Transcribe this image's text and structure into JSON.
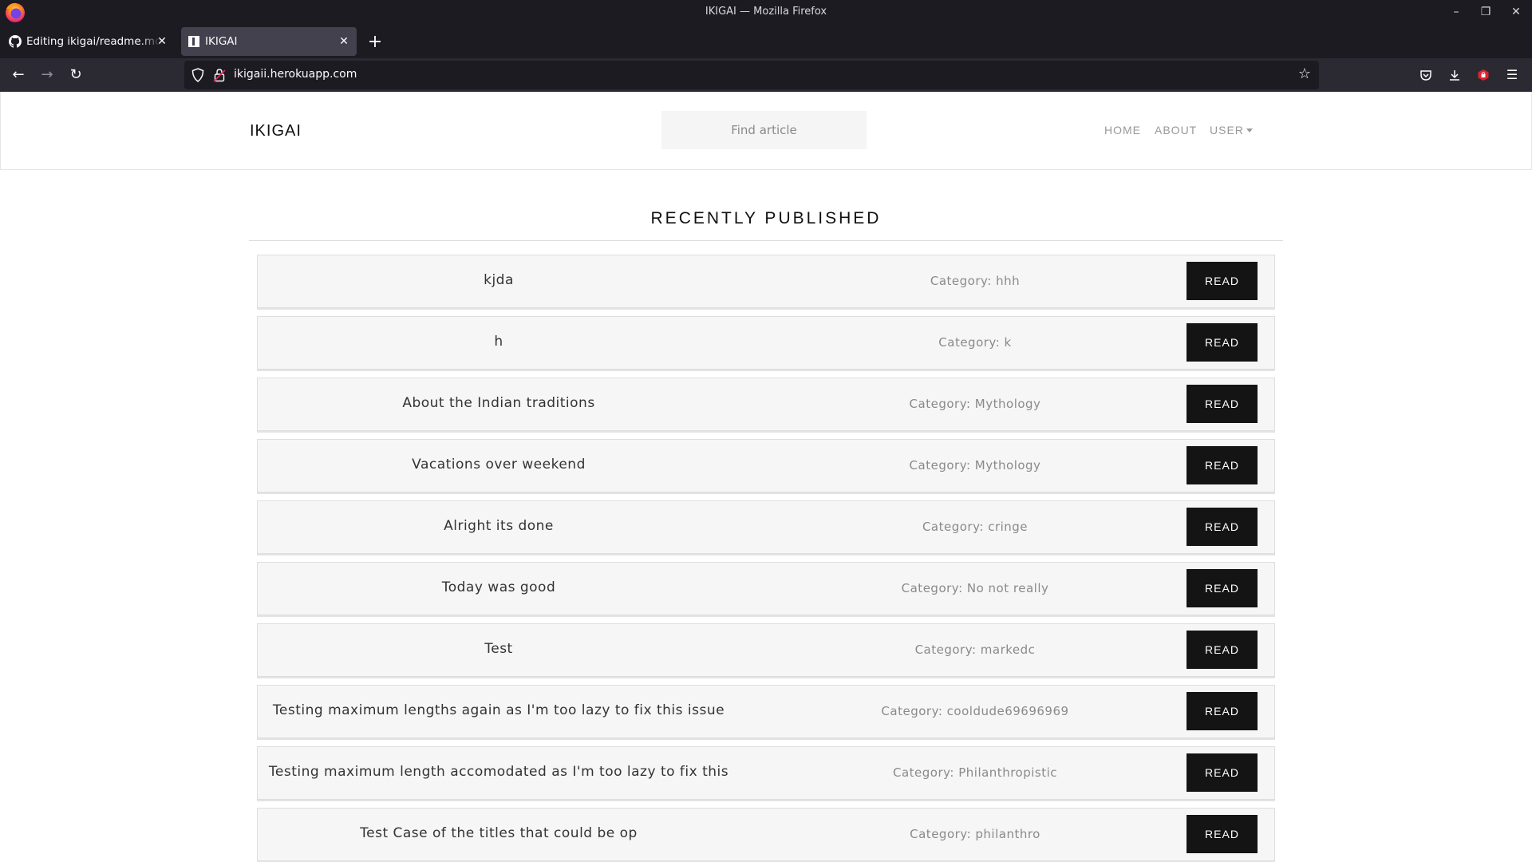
{
  "window": {
    "title": "IKIGAI — Mozilla Firefox"
  },
  "tabs": [
    {
      "title": "Editing ikigai/readme.md at",
      "icon": "github-icon",
      "active": false
    },
    {
      "title": "IKIGAI",
      "icon": "site-favicon",
      "active": true
    }
  ],
  "address_bar": {
    "url": "ikigaii.herokuapp.com"
  },
  "site": {
    "brand": "IKIGAI",
    "search_placeholder": "Find article",
    "menu": {
      "home": "HOME",
      "about": "ABOUT",
      "user": "USER"
    },
    "section_title": "RECENTLY PUBLISHED",
    "read_label": "READ",
    "articles": [
      {
        "title": "kjda",
        "category": "Category: hhh"
      },
      {
        "title": "h",
        "category": "Category: k"
      },
      {
        "title": "About the Indian traditions",
        "category": "Category: Mythology"
      },
      {
        "title": "Vacations over weekend",
        "category": "Category: Mythology"
      },
      {
        "title": "Alright its done",
        "category": "Category: cringe"
      },
      {
        "title": "Today was good",
        "category": "Category: No not really"
      },
      {
        "title": "Test",
        "category": "Category: markedc"
      },
      {
        "title": "Testing maximum lengths again as I'm too lazy to fix this issue",
        "category": "Category: cooldude69696969"
      },
      {
        "title": "Testing maximum length accomodated as I'm too lazy to fix this",
        "category": "Category: Philanthropistic"
      },
      {
        "title": "Test Case of the titles that could be op",
        "category": "Category: philanthro"
      }
    ]
  }
}
